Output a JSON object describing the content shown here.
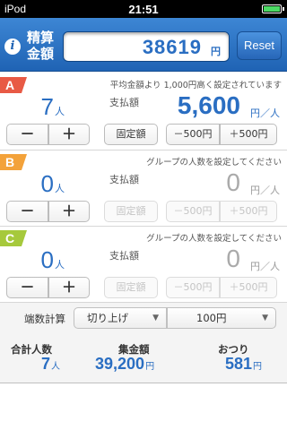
{
  "status": {
    "carrier": "iPod",
    "time": "21:51"
  },
  "header": {
    "label": "精算金額",
    "total": "38619",
    "unit": "円",
    "reset": "Reset"
  },
  "groups": [
    {
      "letter": "A",
      "color": "#e85a45",
      "note": "平均金額より 1,000円高く設定されています",
      "people": "7",
      "people_unit": "人",
      "pay_label": "支払額",
      "pay": "5,600",
      "pay_unit": "円／人",
      "fixed": "固定額",
      "minus500": "－500円",
      "plus500": "＋500円",
      "active": true
    },
    {
      "letter": "B",
      "color": "#f3a23a",
      "note": "グループの人数を設定してください",
      "people": "0",
      "people_unit": "人",
      "pay_label": "支払額",
      "pay": "0",
      "pay_unit": "円／人",
      "fixed": "固定額",
      "minus500": "－500円",
      "plus500": "＋500円",
      "active": false
    },
    {
      "letter": "C",
      "color": "#a6c93c",
      "note": "グループの人数を設定してください",
      "people": "0",
      "people_unit": "人",
      "pay_label": "支払額",
      "pay": "0",
      "pay_unit": "円／人",
      "fixed": "固定額",
      "minus500": "－500円",
      "plus500": "＋500円",
      "active": false
    }
  ],
  "rounding": {
    "label": "端数計算",
    "mode": "切り上げ",
    "unit": "100円"
  },
  "summary": {
    "people_label": "合計人数",
    "people": "7",
    "people_unit": "人",
    "collected_label": "集金額",
    "collected": "39,200",
    "collected_unit": "円",
    "change_label": "おつり",
    "change": "581",
    "change_unit": "円"
  },
  "icons": {
    "info": "info-icon",
    "minus": "－",
    "plus": "＋",
    "caret": "▼"
  }
}
